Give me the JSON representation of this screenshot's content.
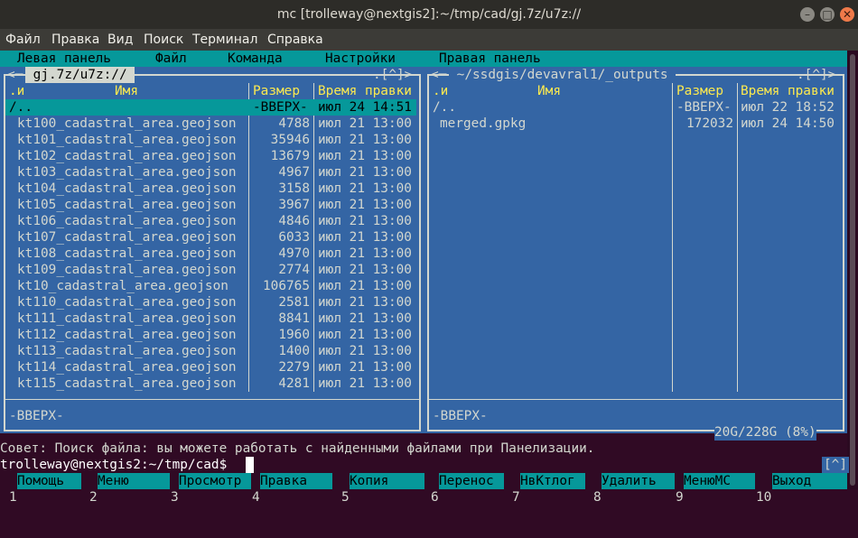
{
  "window": {
    "title": "mc [trolleway@nextgis2]:~/tmp/cad/gj.7z/u7z://",
    "min": "–",
    "max": "□",
    "close": "✕"
  },
  "app_menu": [
    "Файл",
    "Правка",
    "Вид",
    "Поиск",
    "Терминал",
    "Справка"
  ],
  "mc_menu": [
    "Левая панель",
    "Файл",
    "Команда",
    "Настройки",
    "Правая панель"
  ],
  "left_panel": {
    "path": " gj.7z/u7z:// ",
    "corner_left": "<─",
    "corner_right": ".[^]>",
    "headers": {
      "sort": ".и",
      "name": "Имя",
      "size": "Размер",
      "time": "Время правки"
    },
    "files": [
      {
        "name": "/..",
        "size": "-ВВЕРХ-",
        "time": "июл 24 14:51"
      },
      {
        "name": "kt100_cadastral_area.geojson",
        "size": "4788",
        "time": "июл 21 13:00"
      },
      {
        "name": "kt101_cadastral_area.geojson",
        "size": "35946",
        "time": "июл 21 13:00"
      },
      {
        "name": "kt102_cadastral_area.geojson",
        "size": "13679",
        "time": "июл 21 13:00"
      },
      {
        "name": "kt103_cadastral_area.geojson",
        "size": "4967",
        "time": "июл 21 13:00"
      },
      {
        "name": "kt104_cadastral_area.geojson",
        "size": "3158",
        "time": "июл 21 13:00"
      },
      {
        "name": "kt105_cadastral_area.geojson",
        "size": "3967",
        "time": "июл 21 13:00"
      },
      {
        "name": "kt106_cadastral_area.geojson",
        "size": "4846",
        "time": "июл 21 13:00"
      },
      {
        "name": "kt107_cadastral_area.geojson",
        "size": "6033",
        "time": "июл 21 13:00"
      },
      {
        "name": "kt108_cadastral_area.geojson",
        "size": "4970",
        "time": "июл 21 13:00"
      },
      {
        "name": "kt109_cadastral_area.geojson",
        "size": "2774",
        "time": "июл 21 13:00"
      },
      {
        "name": "kt10_cadastral_area.geojson",
        "size": "106765",
        "time": "июл 21 13:00"
      },
      {
        "name": "kt110_cadastral_area.geojson",
        "size": "2581",
        "time": "июл 21 13:00"
      },
      {
        "name": "kt111_cadastral_area.geojson",
        "size": "8841",
        "time": "июл 21 13:00"
      },
      {
        "name": "kt112_cadastral_area.geojson",
        "size": "1960",
        "time": "июл 21 13:00"
      },
      {
        "name": "kt113_cadastral_area.geojson",
        "size": "1400",
        "time": "июл 21 13:00"
      },
      {
        "name": "kt114_cadastral_area.geojson",
        "size": "2279",
        "time": "июл 21 13:00"
      },
      {
        "name": "kt115_cadastral_area.geojson",
        "size": "4281",
        "time": "июл 21 13:00"
      }
    ],
    "status": "-ВВЕРХ-"
  },
  "right_panel": {
    "path": " ~/ssdgis/devavral1/_outputs ",
    "corner_left": "<─",
    "corner_right": ".[^]>",
    "headers": {
      "sort": ".и",
      "name": "Имя",
      "size": "Размер",
      "time": "Время правки"
    },
    "files": [
      {
        "name": "/..",
        "size": "-ВВЕРХ-",
        "time": "июл 22 18:52"
      },
      {
        "name": "merged.gpkg",
        "size": "172032",
        "time": "июл 24 14:50"
      }
    ],
    "status": "-ВВЕРХ-",
    "disk": "20G/228G (8%)"
  },
  "hint": "Совет: Поиск файла: вы можете работать с найденными файлами при Панелизации.",
  "prompt": "trolleway@nextgis2:~/tmp/cad$",
  "history_hint": "[^]",
  "fkeys": [
    {
      "num": "1",
      "label": "Помощь"
    },
    {
      "num": "2",
      "label": "Меню"
    },
    {
      "num": "3",
      "label": "Просмотр"
    },
    {
      "num": "4",
      "label": "Правка"
    },
    {
      "num": "5",
      "label": "Копия"
    },
    {
      "num": "6",
      "label": "Перенос"
    },
    {
      "num": "7",
      "label": "НвКтлог"
    },
    {
      "num": "8",
      "label": "Удалить"
    },
    {
      "num": "9",
      "label": "МенюMC"
    },
    {
      "num": "10",
      "label": "Выход"
    }
  ],
  "colors": {
    "panel": "#3465a4",
    "cyan": "#06989a",
    "header": "#fce94f",
    "bg": "#300a24"
  }
}
